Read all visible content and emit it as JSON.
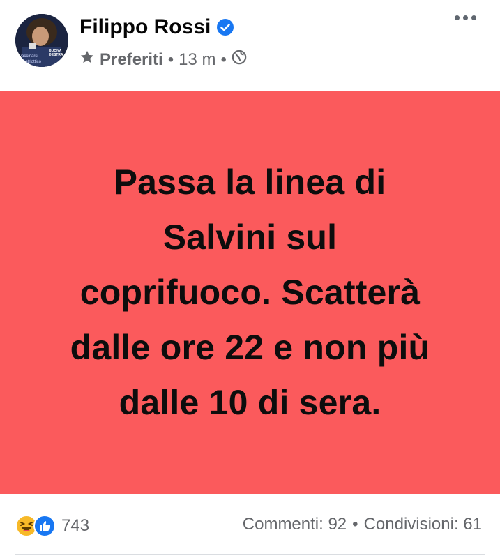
{
  "post": {
    "author": "Filippo Rossi",
    "audience_label": "Preferiti",
    "time": "13 m",
    "separator": "•",
    "body_lines": [
      "Passa la linea di",
      "Salvini sul",
      "coprifuoco. Scatterà",
      "dalle ore 22 e non più",
      "dalle 10 di sera."
    ],
    "card_color": "#fb5a5c",
    "avatar_text": [
      "BUONA",
      "DESTRA",
      "vaccinarsi",
      "è patriottico"
    ]
  },
  "icons": {
    "verified": "verified-badge-icon",
    "favorite": "star-icon",
    "privacy": "globe-icon",
    "more": "more-options-icon",
    "reaction_haha": "haha-reaction-icon",
    "reaction_like": "like-reaction-icon"
  },
  "engagement": {
    "reactions_count": "743",
    "comments_label": "Commenti: 92",
    "shares_label": "Condivisioni: 61",
    "separator": "•"
  }
}
